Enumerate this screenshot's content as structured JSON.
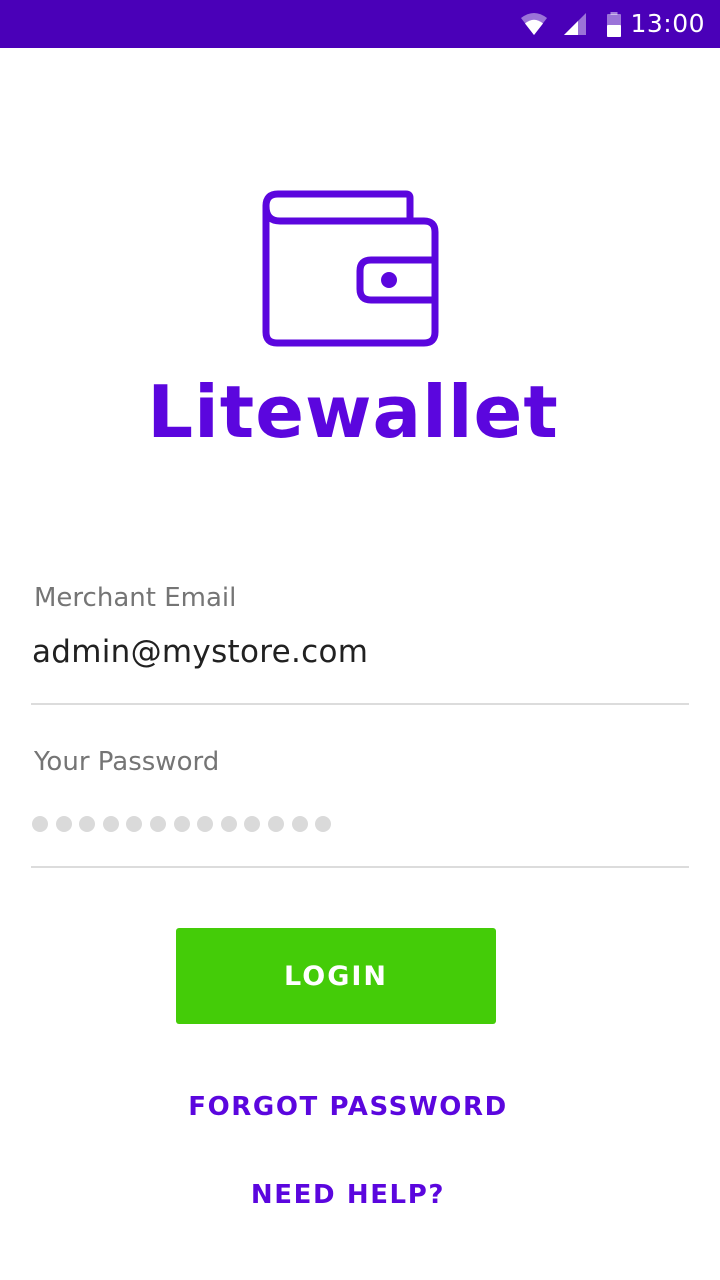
{
  "status_bar": {
    "time": "13:00",
    "icons": [
      "wifi-icon",
      "signal-icon",
      "battery-icon"
    ],
    "background": "#4a00b8"
  },
  "app": {
    "logo_icon": "wallet-icon",
    "title": "Litewallet",
    "brand_color": "#5b06de"
  },
  "form": {
    "email_label": "Merchant Email",
    "email_value": "admin@mystore.com",
    "password_label": "Your Password",
    "password_length": 13
  },
  "actions": {
    "login_label": "LOGIN",
    "login_color": "#44cc08",
    "forgot_password_label": "FORGOT PASSWORD",
    "need_help_label": "NEED HELP?"
  }
}
